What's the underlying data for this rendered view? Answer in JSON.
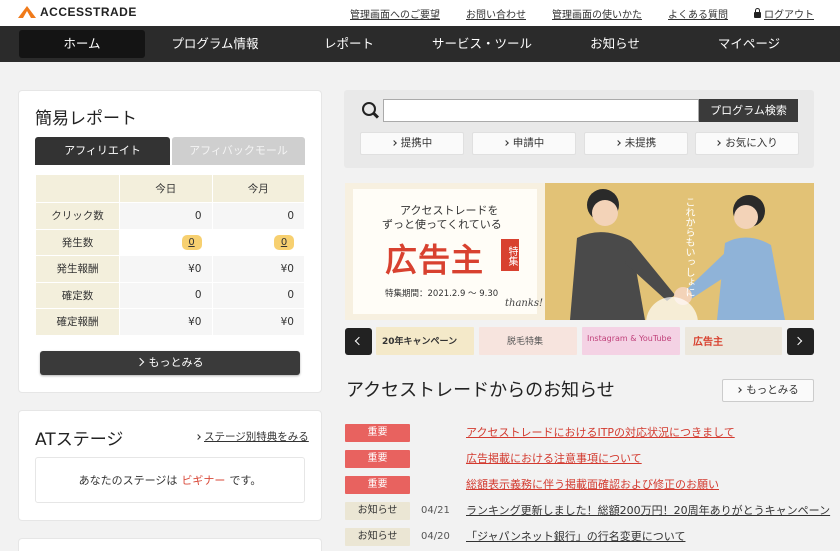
{
  "header": {
    "logo": "ACCESSTRADE",
    "links": [
      "管理画面へのご要望",
      "お問い合わせ",
      "管理画面の使いかた",
      "よくある質問"
    ],
    "logout": "ログアウト"
  },
  "nav": [
    "ホーム",
    "プログラム情報",
    "レポート",
    "サービス・ツール",
    "お知らせ",
    "マイページ"
  ],
  "report": {
    "title": "簡易レポート",
    "tabs": [
      "アフィリエイト",
      "アフィバックモール"
    ],
    "columns": [
      "今日",
      "今月"
    ],
    "rows": [
      {
        "label": "クリック数",
        "today": "0",
        "month": "0"
      },
      {
        "label": "発生数",
        "today": "0",
        "month": "0"
      },
      {
        "label": "発生報酬",
        "today": "¥0",
        "month": "¥0"
      },
      {
        "label": "確定数",
        "today": "0",
        "month": "0"
      },
      {
        "label": "確定報酬",
        "today": "¥0",
        "month": "¥0"
      }
    ],
    "more": "もっとみる"
  },
  "stage": {
    "title": "ATステージ",
    "link": "ステージ別特典をみる",
    "prefix": "あなたのステージは",
    "level": "ビギナー",
    "suffix": "です。"
  },
  "search": {
    "placeholder": "",
    "button": "プログラム検索",
    "filters": [
      "提携中",
      "申請中",
      "未提携",
      "お気に入り"
    ]
  },
  "banner": {
    "line1": "アクセストレードを",
    "line2": "ずっと使ってくれている",
    "main": "広告主",
    "tokushu": "特集",
    "period": "特集期間：2021.2.9 〜 9.30",
    "thanks": "thanks!",
    "bubble": "これからもいっしょに",
    "thumbs": [
      "20年キャンペーン",
      "脱毛特集",
      "Instagram & YouTube",
      "広告主"
    ]
  },
  "news": {
    "title": "アクセストレードからのお知らせ",
    "more": "もっとみる",
    "items": [
      {
        "tag": "重要",
        "date": "",
        "text": "アクセストレードにおけるITPの対応状況につきまして",
        "important": true
      },
      {
        "tag": "重要",
        "date": "",
        "text": "広告掲載における注意事項について",
        "important": true
      },
      {
        "tag": "重要",
        "date": "",
        "text": "総額表示義務に伴う掲載面確認および修正のお願い",
        "important": true
      },
      {
        "tag": "お知らせ",
        "date": "04/21",
        "text": "ランキング更新しました！総額200万円！20周年ありがとうキャンペーン",
        "important": false
      },
      {
        "tag": "お知らせ",
        "date": "04/20",
        "text": "「ジャパンネット銀行」の行名変更について",
        "important": false
      }
    ]
  }
}
